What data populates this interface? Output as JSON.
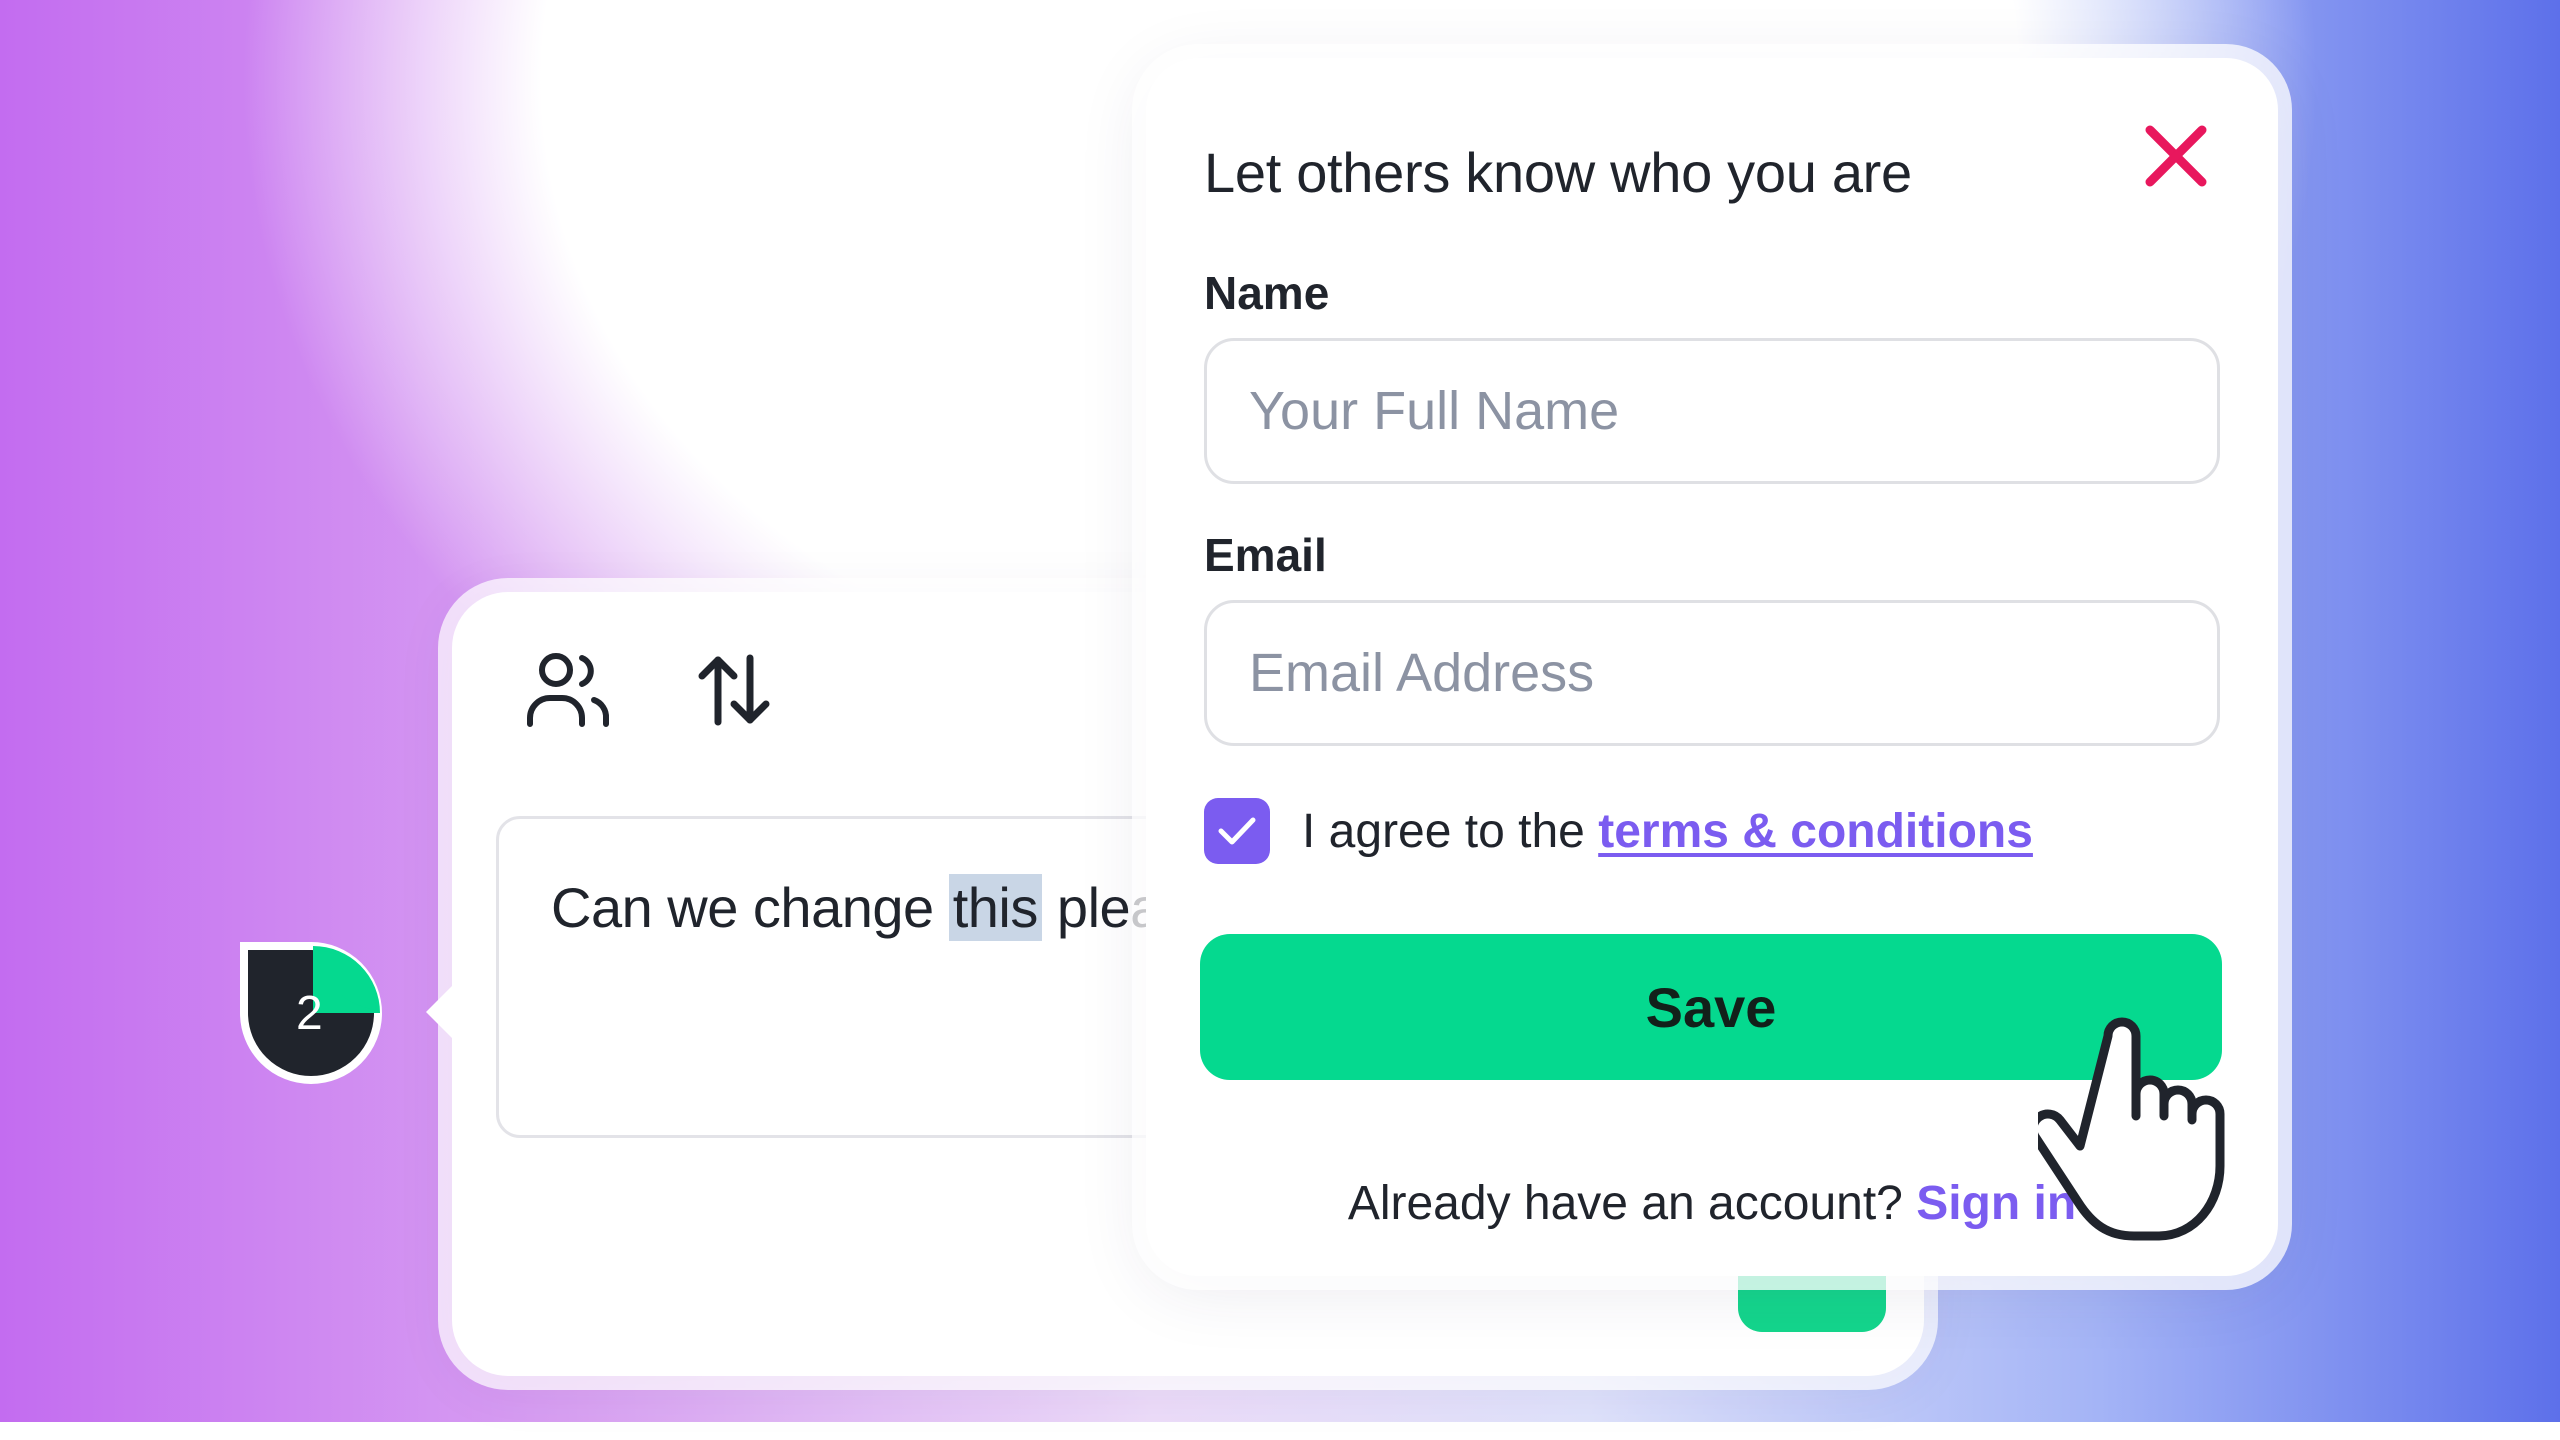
{
  "comment": {
    "text_before": "Can we change ",
    "text_highlight": "this",
    "text_after": " pleas",
    "avatar_count": "2"
  },
  "modal": {
    "title": "Let others know who you are",
    "name_label": "Name",
    "name_placeholder": "Your Full Name",
    "name_value": "",
    "email_label": "Email",
    "email_placeholder": "Email Address",
    "email_value": "",
    "agree_prefix": "I agree to the ",
    "agree_link": "terms & conditions",
    "agree_checked": true,
    "save_label": "Save",
    "signin_prefix": "Already have an account? ",
    "signin_link": "Sign in"
  },
  "icons": {
    "users": "users-icon",
    "sort": "sort-arrows-icon",
    "close": "close-icon",
    "check": "check-icon",
    "cursor": "hand-pointer-cursor"
  },
  "colors": {
    "accent_green": "#05d98f",
    "accent_purple": "#7b5cf0",
    "close_red": "#e8175d",
    "dark": "#20242c"
  }
}
